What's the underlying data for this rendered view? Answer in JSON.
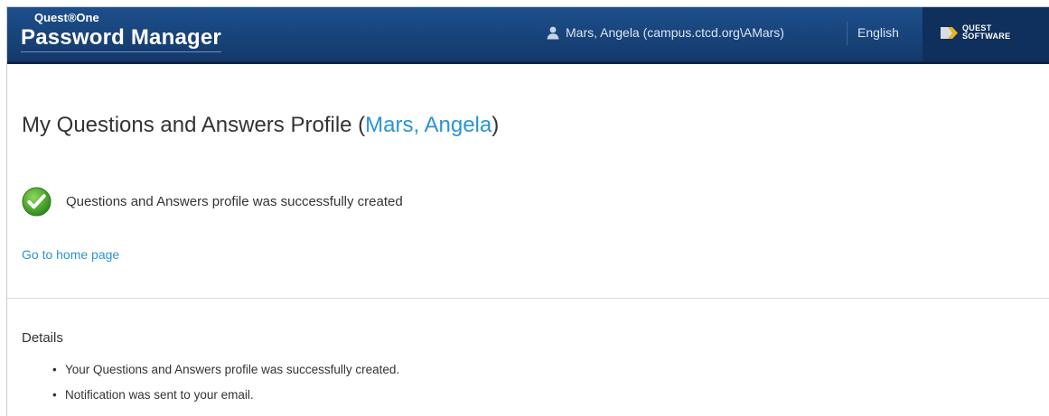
{
  "header": {
    "product_line": "Quest®One",
    "app_title": "Password Manager",
    "user_label": "Mars, Angela (campus.ctcd.org\\AMars)",
    "language": "English",
    "vendor_logo_text_line1": "QUEST",
    "vendor_logo_text_line2": "SOFTWARE",
    "colors": {
      "header_bg": "#1d4f8c",
      "vendor_bg": "#0f2f5c"
    }
  },
  "main": {
    "title_prefix": "My Questions and Answers Profile (",
    "title_name": "Mars, Angela",
    "title_suffix": ")",
    "status_icon": "success-check-icon",
    "status_message": "Questions and Answers profile was successfully created",
    "home_link": "Go to home page",
    "link_color": "#2a94d6"
  },
  "details": {
    "heading": "Details",
    "items": [
      "Your Questions and Answers profile was successfully created.",
      "Notification was sent to your email."
    ],
    "bullet": "•"
  }
}
